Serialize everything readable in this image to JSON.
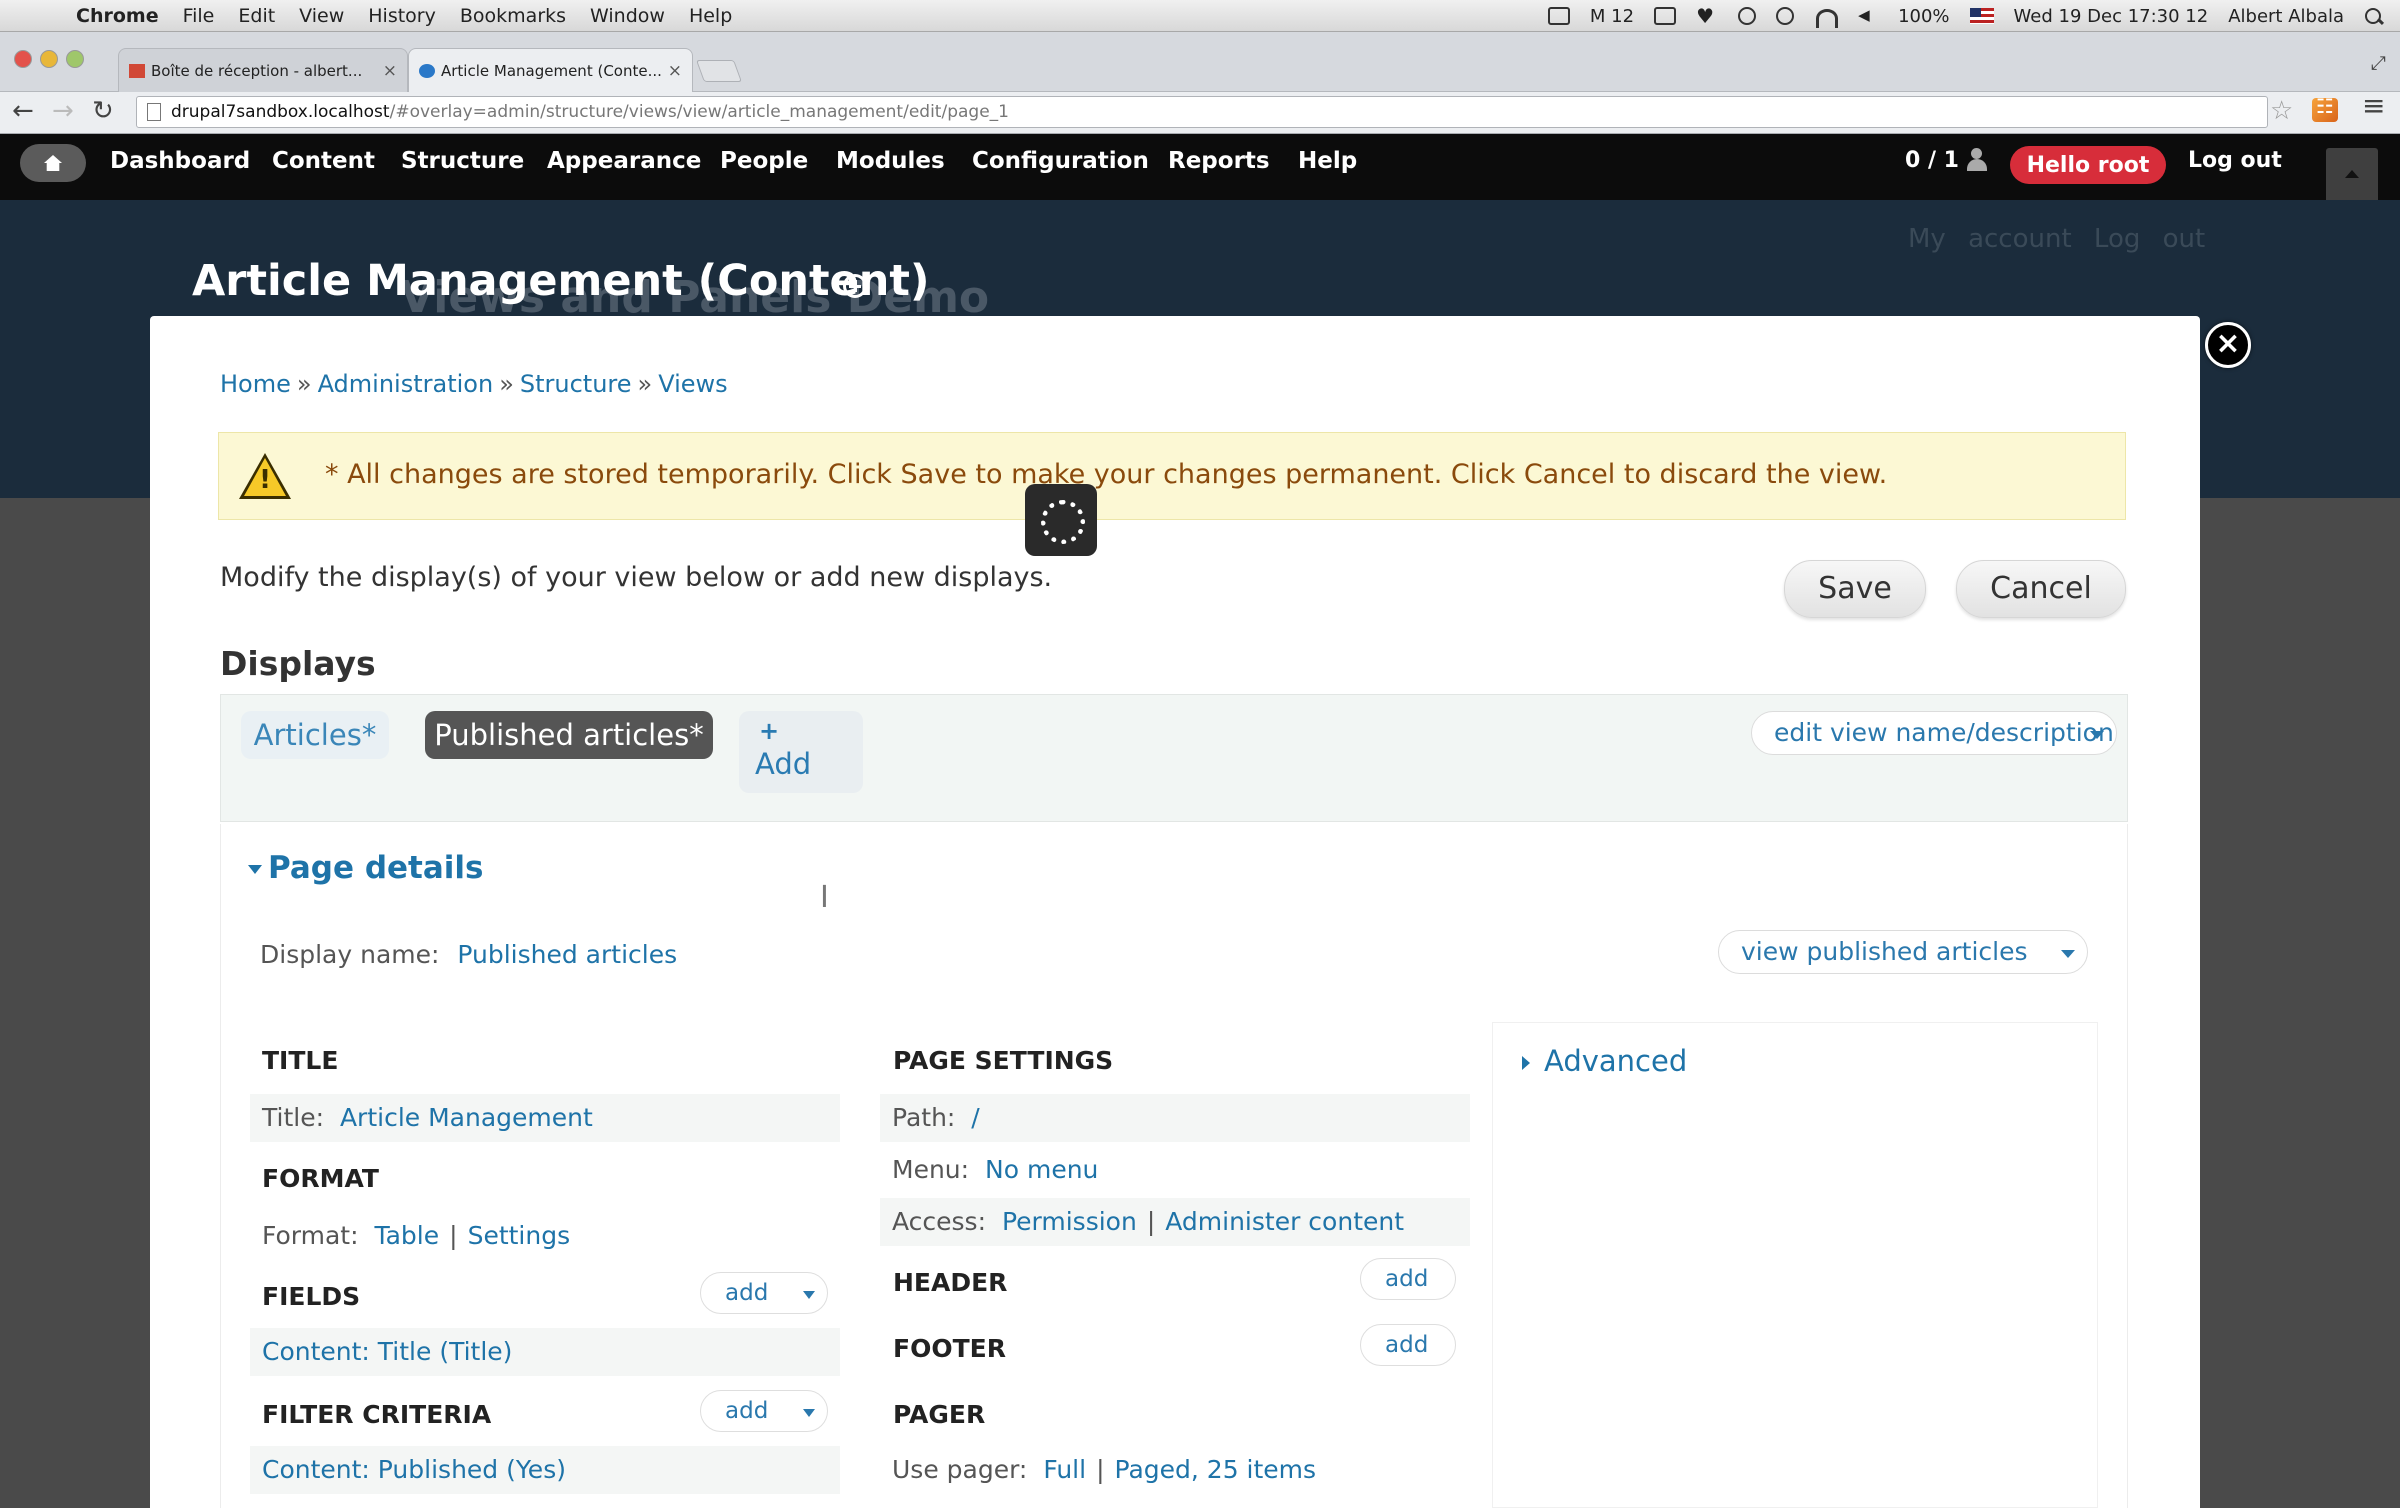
{
  "menubar": {
    "app": "Chrome",
    "items": [
      "File",
      "Edit",
      "View",
      "History",
      "Bookmarks",
      "Window",
      "Help"
    ],
    "status_badge": "M 12",
    "battery": "100%",
    "datetime": "Wed 19 Dec  17:30 12",
    "user": "Albert Albala"
  },
  "tabs": [
    {
      "title": "Boîte de réception - albert...",
      "close": "×"
    },
    {
      "title": "Article Management (Conte...",
      "close": "×"
    }
  ],
  "address": {
    "host": "drupal7sandbox.localhost",
    "path": "/#overlay=admin/structure/views/view/article_management/edit/page_1"
  },
  "toolbar": {
    "items": [
      "Dashboard",
      "Content",
      "Structure",
      "Appearance",
      "People",
      "Modules",
      "Configuration",
      "Reports",
      "Help"
    ],
    "shortcut_count": "0 / 1",
    "hello": "Hello root",
    "logout": "Log out"
  },
  "site": {
    "account_links": "My account  Log out",
    "name": "Views and Panels Demo"
  },
  "overlay": {
    "title": "Article Management (Content)",
    "close": "×"
  },
  "breadcrumb": [
    "Home",
    "Administration",
    "Structure",
    "Views"
  ],
  "breadcrumb_sep": "»",
  "warning": "* All changes are stored temporarily. Click Save to make your changes permanent. Click Cancel to discard the view.",
  "intro": "Modify the display(s) of your view below or add new displays.",
  "buttons": {
    "save": "Save",
    "cancel": "Cancel"
  },
  "displays": {
    "heading": "Displays",
    "tabs": [
      "Articles*",
      "Published articles*"
    ],
    "add_plus": "+",
    "add": "Add",
    "edit_name": "edit view name/description"
  },
  "details": {
    "toggle": "Page details",
    "display_name_label": "Display name:",
    "display_name_value": "Published articles",
    "view_button": "view published articles",
    "title_head": "TITLE",
    "title_label": "Title:",
    "title_value": "Article Management",
    "format_head": "FORMAT",
    "format_label": "Format:",
    "format_value": "Table",
    "format_settings": "Settings",
    "fields_head": "FIELDS",
    "fields_add": "add",
    "fields_value": "Content: Title (Title)",
    "filter_head": "FILTER CRITERIA",
    "filter_add": "add",
    "filter_value": "Content: Published (Yes)",
    "page_settings_head": "PAGE SETTINGS",
    "path_label": "Path:",
    "path_value": "/",
    "menu_label": "Menu:",
    "menu_value": "No menu",
    "access_label": "Access:",
    "access_value1": "Permission",
    "access_value2": "Administer content",
    "header_head": "HEADER",
    "header_add": "add",
    "footer_head": "FOOTER",
    "footer_add": "add",
    "pager_head": "PAGER",
    "pager_label": "Use pager:",
    "pager_value1": "Full",
    "pager_value2": "Paged, 25 items",
    "advanced": "Advanced",
    "pipe": "|"
  }
}
